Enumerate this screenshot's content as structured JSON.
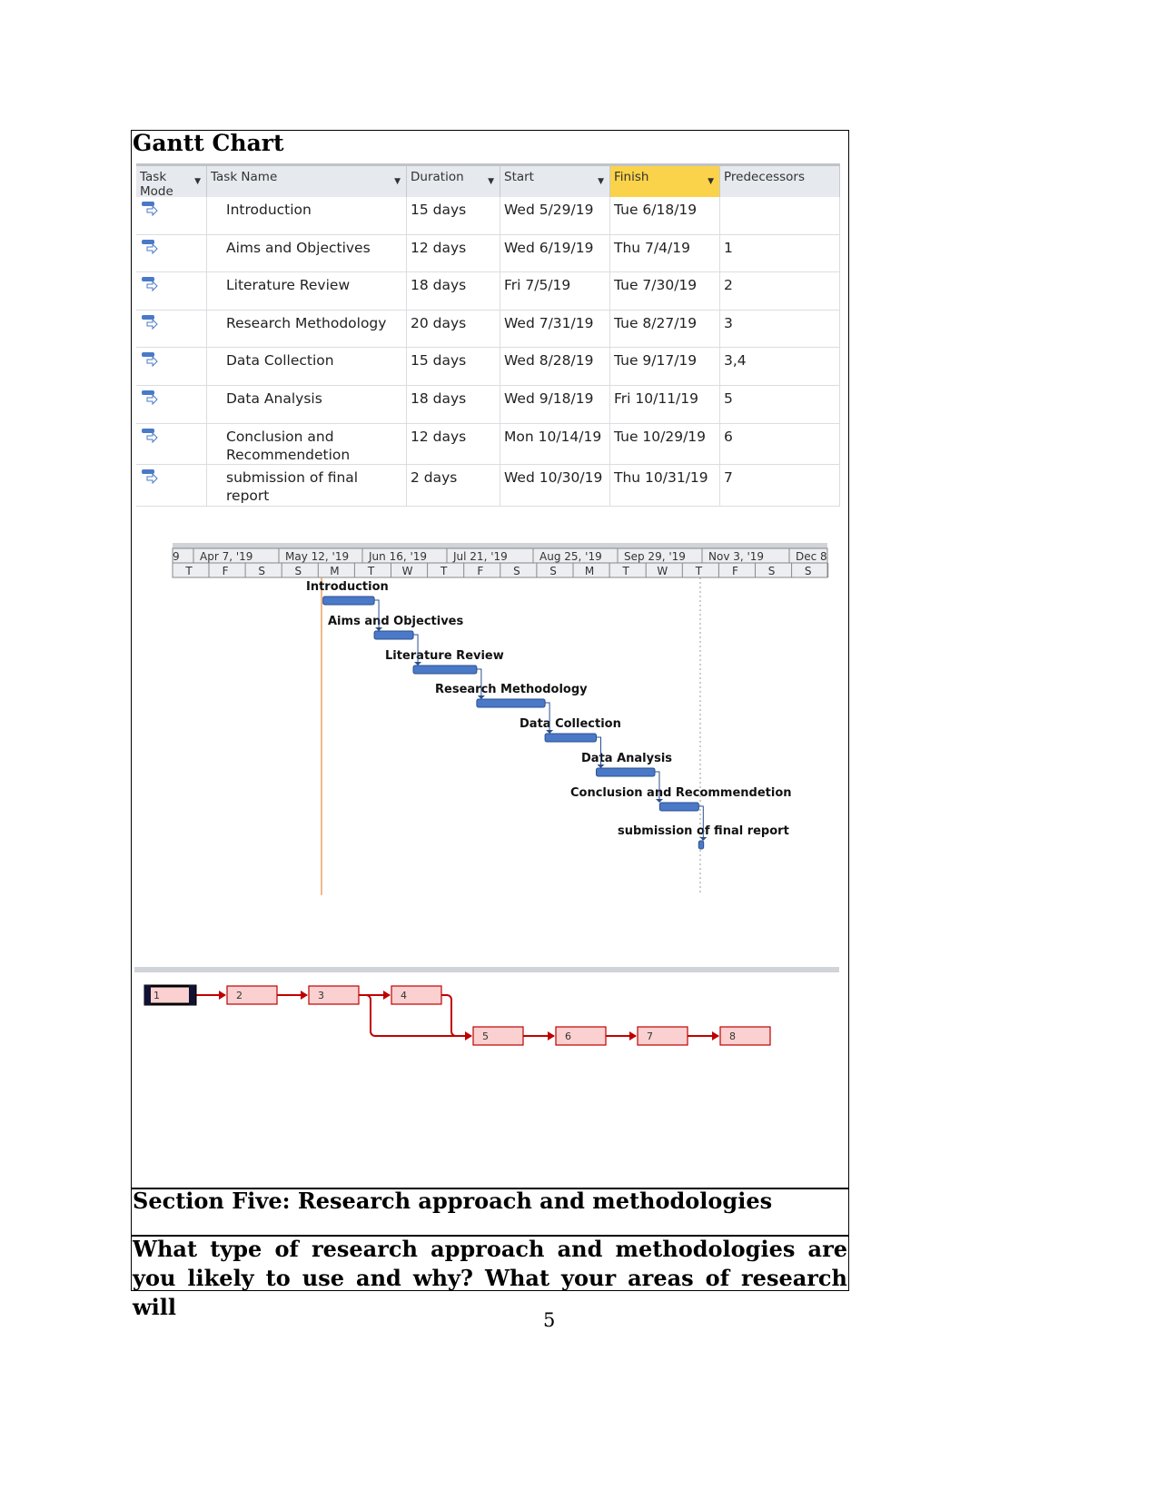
{
  "title": "Gantt Chart",
  "table": {
    "columns": [
      "Task Mode",
      "Task Name",
      "Duration",
      "Start",
      "Finish",
      "Predecessors"
    ],
    "rows": [
      {
        "id": 1,
        "name": "Introduction",
        "duration": "15 days",
        "start": "Wed 5/29/19",
        "finish": "Tue 6/18/19",
        "pred": ""
      },
      {
        "id": 2,
        "name": "Aims and Objectives",
        "duration": "12 days",
        "start": "Wed 6/19/19",
        "finish": "Thu 7/4/19",
        "pred": "1"
      },
      {
        "id": 3,
        "name": "Literature Review",
        "duration": "18 days",
        "start": "Fri 7/5/19",
        "finish": "Tue 7/30/19",
        "pred": "2"
      },
      {
        "id": 4,
        "name": "Research Methodology",
        "duration": "20 days",
        "start": "Wed 7/31/19",
        "finish": "Tue 8/27/19",
        "pred": "3"
      },
      {
        "id": 5,
        "name": "Data Collection",
        "duration": "15 days",
        "start": "Wed 8/28/19",
        "finish": "Tue 9/17/19",
        "pred": "3,4"
      },
      {
        "id": 6,
        "name": "Data Analysis",
        "duration": "18 days",
        "start": "Wed 9/18/19",
        "finish": "Fri 10/11/19",
        "pred": "5"
      },
      {
        "id": 7,
        "name": "Conclusion and Recommendetion",
        "duration": "12 days",
        "start": "Mon 10/14/19",
        "finish": "Tue 10/29/19",
        "pred": "6"
      },
      {
        "id": 8,
        "name": "submission of final report",
        "duration": "2 days",
        "start": "Wed 10/30/19",
        "finish": "Thu 10/31/19",
        "pred": "7"
      }
    ]
  },
  "timeline": {
    "weeks": [
      "9",
      "Apr 7, '19",
      "May 12, '19",
      "Jun 16, '19",
      "Jul 21, '19",
      "Aug 25, '19",
      "Sep 29, '19",
      "Nov 3, '19",
      "Dec 8"
    ],
    "days": [
      "T",
      "F",
      "S",
      "S",
      "M",
      "T",
      "W",
      "T",
      "F",
      "S",
      "S",
      "M",
      "T",
      "W",
      "T",
      "F",
      "S",
      "S"
    ],
    "bar_color": "#4a79c8",
    "today_line_color": "#f0a060"
  },
  "network": {
    "nodes": [
      "1",
      "2",
      "3",
      "4",
      "5",
      "6",
      "7",
      "8"
    ],
    "color": "#c00000",
    "fill": "#fbd0d0"
  },
  "section_heading": "Section Five: Research approach and methodologies",
  "question": "What type of research approach and methodologies are you likely to use and why? What your areas of research will",
  "page_number": "5"
}
